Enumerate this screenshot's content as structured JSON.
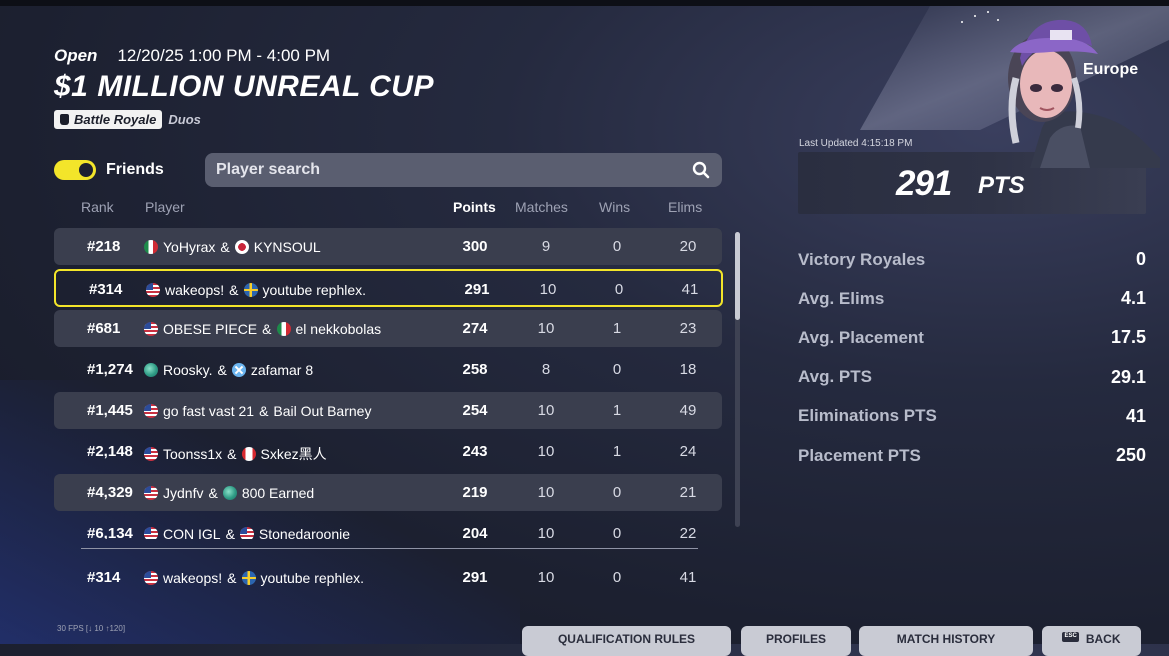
{
  "header": {
    "status": "Open",
    "datetime": "12/20/25 1:00 PM - 4:00 PM",
    "title": "$1 MILLION UNREAL CUP",
    "mode": "Battle Royale",
    "mode_type": "Duos",
    "mode_icon": "bag-icon"
  },
  "friends_toggle": {
    "label": "Friends",
    "on": true
  },
  "search": {
    "placeholder": "Player search",
    "value": ""
  },
  "columns": {
    "rank": "Rank",
    "player": "Player",
    "points": "Points",
    "matches": "Matches",
    "wins": "Wins",
    "elims": "Elims"
  },
  "rows": [
    {
      "rank": "#218",
      "p1": "YoHyrax",
      "f1": "mx",
      "amp": "&",
      "p2": "KYNSOUL",
      "f2": "jp",
      "points": "300",
      "matches": "9",
      "wins": "0",
      "elims": "20"
    },
    {
      "rank": "#314",
      "p1": "wakeops!",
      "f1": "us",
      "amp": "&",
      "p2": "youtube rephlex.",
      "f2": "se",
      "points": "291",
      "matches": "10",
      "wins": "0",
      "elims": "41"
    },
    {
      "rank": "#681",
      "p1": "OBESE PIECE",
      "f1": "us",
      "amp": "&",
      "p2": "el nekkobolas",
      "f2": "mx",
      "points": "274",
      "matches": "10",
      "wins": "1",
      "elims": "23"
    },
    {
      "rank": "#1,274",
      "p1": "Roosky.",
      "f1": "globe",
      "amp": "&",
      "p2": "zafamar 8",
      "f2": "x",
      "points": "258",
      "matches": "8",
      "wins": "0",
      "elims": "18"
    },
    {
      "rank": "#1,445",
      "p1": "go fast vast 21",
      "f1": "us",
      "amp": "&",
      "p2": "Bail Out Barney",
      "f2": "",
      "points": "254",
      "matches": "10",
      "wins": "1",
      "elims": "49"
    },
    {
      "rank": "#2,148",
      "p1": "Toonss1x",
      "f1": "us",
      "amp": "&",
      "p2": "Sxkez黑人",
      "f2": "ca",
      "points": "243",
      "matches": "10",
      "wins": "1",
      "elims": "24"
    },
    {
      "rank": "#4,329",
      "p1": "Jydnfv",
      "f1": "us",
      "amp": "&",
      "p2": "800 Earned",
      "f2": "globe",
      "points": "219",
      "matches": "10",
      "wins": "0",
      "elims": "21"
    },
    {
      "rank": "#6,134",
      "p1": "CON IGL",
      "f1": "us",
      "amp": "&",
      "p2": "Stonedaroonie",
      "f2": "us",
      "points": "204",
      "matches": "10",
      "wins": "0",
      "elims": "22"
    }
  ],
  "pinned_row": {
    "rank": "#314",
    "p1": "wakeops!",
    "f1": "us",
    "amp": "&",
    "p2": "youtube rephlex.",
    "f2": "se",
    "points": "291",
    "matches": "10",
    "wins": "0",
    "elims": "41"
  },
  "summary": {
    "region": "Europe",
    "last_updated": "Last Updated 4:15:18 PM",
    "points_value": "291",
    "points_unit": "PTS",
    "stats": [
      {
        "label": "Victory Royales",
        "value": "0"
      },
      {
        "label": "Avg. Elims",
        "value": "4.1"
      },
      {
        "label": "Avg. Placement",
        "value": "17.5"
      },
      {
        "label": "Avg. PTS",
        "value": "29.1"
      },
      {
        "label": "Eliminations PTS",
        "value": "41"
      },
      {
        "label": "Placement PTS",
        "value": "250"
      }
    ]
  },
  "footer": {
    "fps": "30 FPS [↓ 10 ↑120]",
    "buttons": [
      {
        "label": "QUALIFICATION RULES"
      },
      {
        "label": "PROFILES"
      },
      {
        "label": "MATCH HISTORY"
      },
      {
        "label": "BACK",
        "key": "ESC"
      }
    ]
  },
  "colors": {
    "accent": "#f3e52a",
    "row_alt": "#3a3e4e",
    "search_bg": "#5a5e70"
  }
}
